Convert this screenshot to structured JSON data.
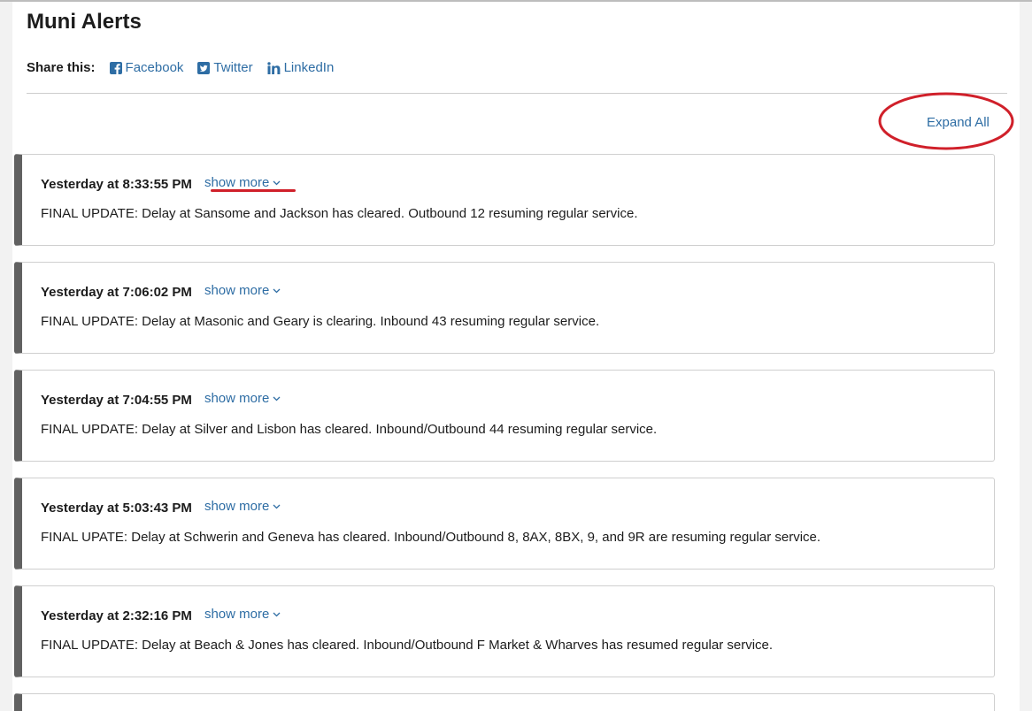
{
  "page": {
    "title": "Muni Alerts"
  },
  "share": {
    "label": "Share this:",
    "links": [
      {
        "label": "Facebook",
        "icon": "facebook-icon"
      },
      {
        "label": "Twitter",
        "icon": "twitter-icon"
      },
      {
        "label": "LinkedIn",
        "icon": "linkedin-icon"
      }
    ]
  },
  "controls": {
    "expand_all_label": "Expand All"
  },
  "alerts": [
    {
      "time": "Yesterday at 8:33:55 PM",
      "show_more": "show more",
      "text": "FINAL UPDATE: Delay at Sansome and Jackson has cleared. Outbound 12 resuming regular service."
    },
    {
      "time": "Yesterday at 7:06:02 PM",
      "show_more": "show more",
      "text": "FINAL UPDATE: Delay at Masonic and Geary is clearing. Inbound 43 resuming regular service."
    },
    {
      "time": "Yesterday at 7:04:55 PM",
      "show_more": "show more",
      "text": "FINAL UPDATE: Delay at Silver and Lisbon has cleared. Inbound/Outbound 44 resuming regular service."
    },
    {
      "time": "Yesterday at 5:03:43 PM",
      "show_more": "show more",
      "text": "FINAL UPATE: Delay at Schwerin and Geneva has cleared. Inbound/Outbound 8, 8AX, 8BX, 9, and 9R are resuming regular service."
    },
    {
      "time": "Yesterday at 2:32:16 PM",
      "show_more": "show more",
      "text": "FINAL UPDATE: Delay at Beach & Jones has cleared. Inbound/Outbound F Market & Wharves has resumed regular service."
    }
  ],
  "colors": {
    "link": "#2e6da4",
    "card_accent": "#616161",
    "annotation": "#d0202a"
  }
}
